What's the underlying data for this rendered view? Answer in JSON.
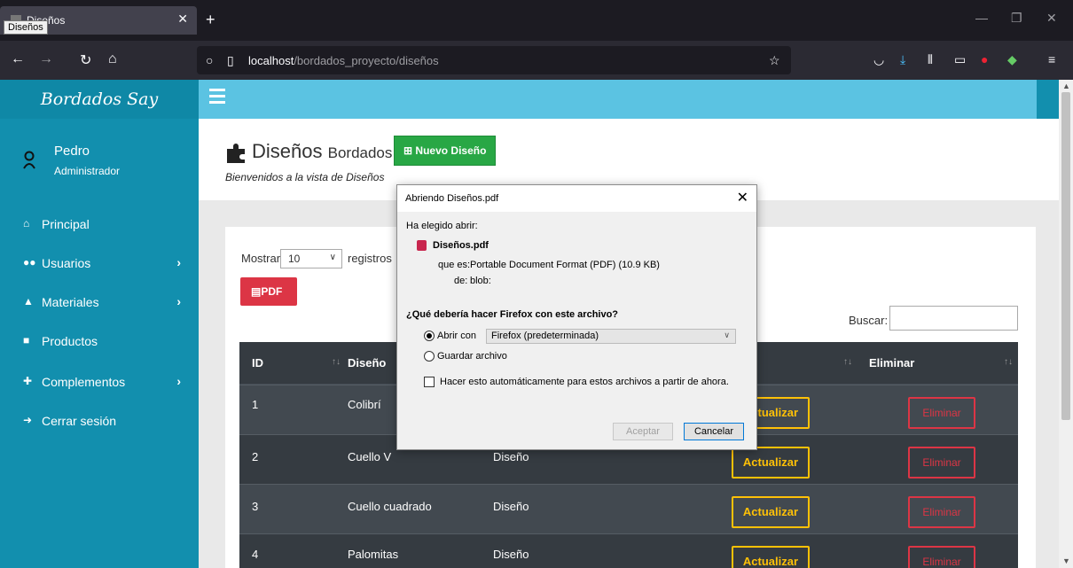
{
  "browser": {
    "tab_title": "Diseños",
    "tooltip": "Diseños",
    "url_host": "localhost",
    "url_path": "/bordados_proyecto/diseños"
  },
  "sidebar": {
    "brand": "Bordados Say",
    "user_name": "Pedro",
    "user_role": "Administrador",
    "items": [
      {
        "label": "Principal",
        "icon": "home-icon",
        "arrow": ""
      },
      {
        "label": "Usuarios",
        "icon": "users-icon",
        "arrow": "›"
      },
      {
        "label": "Materiales",
        "icon": "car-icon",
        "arrow": "›"
      },
      {
        "label": "Productos",
        "icon": "bag-icon",
        "arrow": ""
      },
      {
        "label": "Complementos",
        "icon": "puzzle-icon",
        "arrow": "›"
      },
      {
        "label": "Cerrar sesión",
        "icon": "sign-out-icon",
        "arrow": ""
      }
    ]
  },
  "header": {
    "title": "Diseños",
    "title_small": "Bordados",
    "new_button": "Nuevo Diseño",
    "subtitle": "Bienvenidos a la vista de Diseños"
  },
  "card": {
    "show_label": "Mostrar",
    "show_value": "10",
    "records_label": "registros",
    "pdf_button": "PDF",
    "search_label": "Buscar:"
  },
  "table": {
    "headers": [
      "ID",
      "Diseño",
      "Eliminar"
    ],
    "rows": [
      {
        "id": "1",
        "name": "Colibrí",
        "type": "",
        "update": "Actualizar",
        "delete": "Eliminar"
      },
      {
        "id": "2",
        "name": "Cuello V",
        "type": "Diseño",
        "update": "Actualizar",
        "delete": "Eliminar"
      },
      {
        "id": "3",
        "name": "Cuello cuadrado",
        "type": "Diseño",
        "update": "Actualizar",
        "delete": "Eliminar"
      },
      {
        "id": "4",
        "name": "Palomitas",
        "type": "Diseño",
        "update": "Actualizar",
        "delete": "Eliminar"
      }
    ]
  },
  "dialog": {
    "title": "Abriendo Diseños.pdf",
    "chosen": "Ha elegido abrir:",
    "file_name": "Diseños.pdf",
    "which_is_label": "que es:",
    "which_is_value": "Portable Document Format (PDF) (10.9 KB)",
    "from_label": "de:",
    "from_value": "blob:",
    "question": "¿Qué debería hacer Firefox con este archivo?",
    "open_with": "Abrir con",
    "open_with_value": "Firefox (predeterminada)",
    "save_file": "Guardar archivo",
    "auto": "Hacer esto automáticamente para estos archivos a partir de ahora.",
    "accept": "Aceptar",
    "cancel": "Cancelar"
  },
  "colors": {
    "sidebar": "#128fae",
    "topbar": "#5bc3e2",
    "success": "#28a745",
    "danger": "#dc3545",
    "warning": "#ffc107"
  }
}
